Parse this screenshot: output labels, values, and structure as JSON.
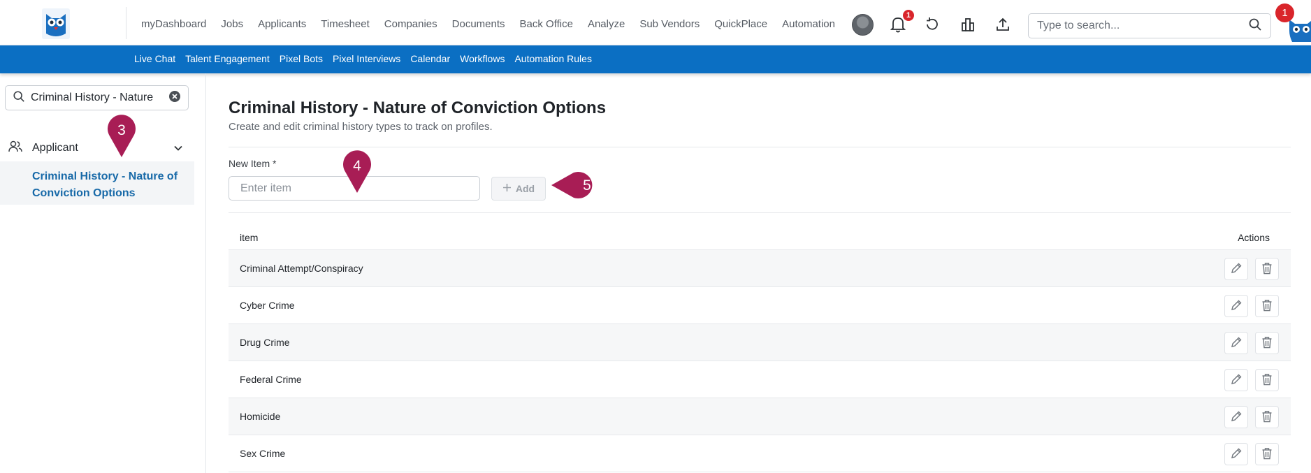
{
  "nav": {
    "items": [
      "myDashboard",
      "Jobs",
      "Applicants",
      "Timesheet",
      "Companies",
      "Documents",
      "Back Office",
      "Analyze",
      "Sub Vendors",
      "QuickPlace",
      "Automation"
    ],
    "notification_count": "1",
    "search_placeholder": "Type to search...",
    "profile_badge": "1"
  },
  "subnav": {
    "items": [
      "Live Chat",
      "Talent Engagement",
      "Pixel Bots",
      "Pixel Interviews",
      "Calendar",
      "Workflows",
      "Automation Rules"
    ]
  },
  "sidebar": {
    "search_value": "Criminal History - Nature",
    "group_label": "Applicant",
    "active_item_line1": "Criminal History - Nature of",
    "active_item_line2": "Conviction Options"
  },
  "page": {
    "title": "Criminal History - Nature of Conviction Options",
    "subtitle": "Create and edit criminal history types to track on profiles.",
    "new_item_label": "New Item *",
    "new_item_placeholder": "Enter item",
    "add_label": "Add"
  },
  "table": {
    "col_item": "item",
    "col_actions": "Actions",
    "rows": [
      "Criminal Attempt/Conspiracy",
      "Cyber Crime",
      "Drug Crime",
      "Federal Crime",
      "Homicide",
      "Sex Crime"
    ]
  },
  "annotations": {
    "marker_3": "3",
    "marker_4": "4",
    "marker_5": "5",
    "color": "#a81d55"
  },
  "colors": {
    "primary": "#0b6fc3",
    "sidebar_active_text": "#1769a8",
    "badge": "#d9252b"
  }
}
